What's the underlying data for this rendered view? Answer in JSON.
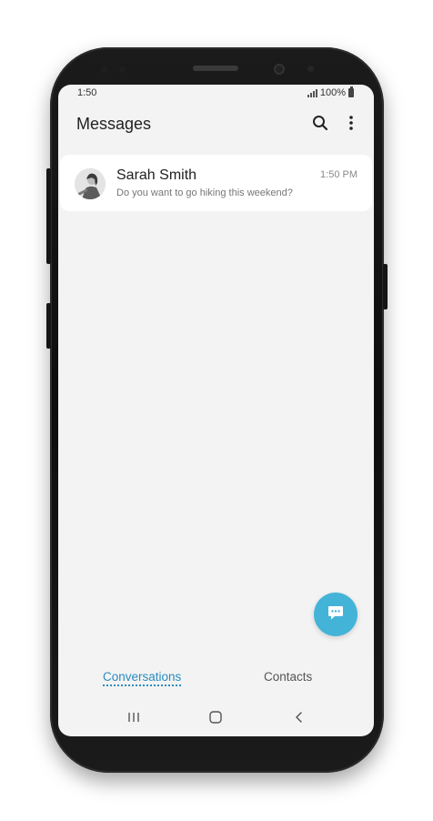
{
  "status_bar": {
    "time": "1:50",
    "battery": "100%"
  },
  "app_bar": {
    "title": "Messages",
    "search_icon": "search-icon",
    "more_icon": "more-vertical-icon"
  },
  "conversations": [
    {
      "name": "Sarah Smith",
      "preview": "Do you want to go hiking this weekend?",
      "time": "1:50 PM"
    }
  ],
  "fab": {
    "icon": "new-message-icon",
    "color": "#44b3d8"
  },
  "tabs": [
    {
      "label": "Conversations",
      "active": true
    },
    {
      "label": "Contacts",
      "active": false
    }
  ],
  "nav_bar": {
    "icons": [
      "recent-apps-icon",
      "home-icon",
      "back-icon"
    ]
  },
  "colors": {
    "accent": "#2a8cbf",
    "screen_background": "#f3f3f3",
    "phone_body": "#111111"
  }
}
